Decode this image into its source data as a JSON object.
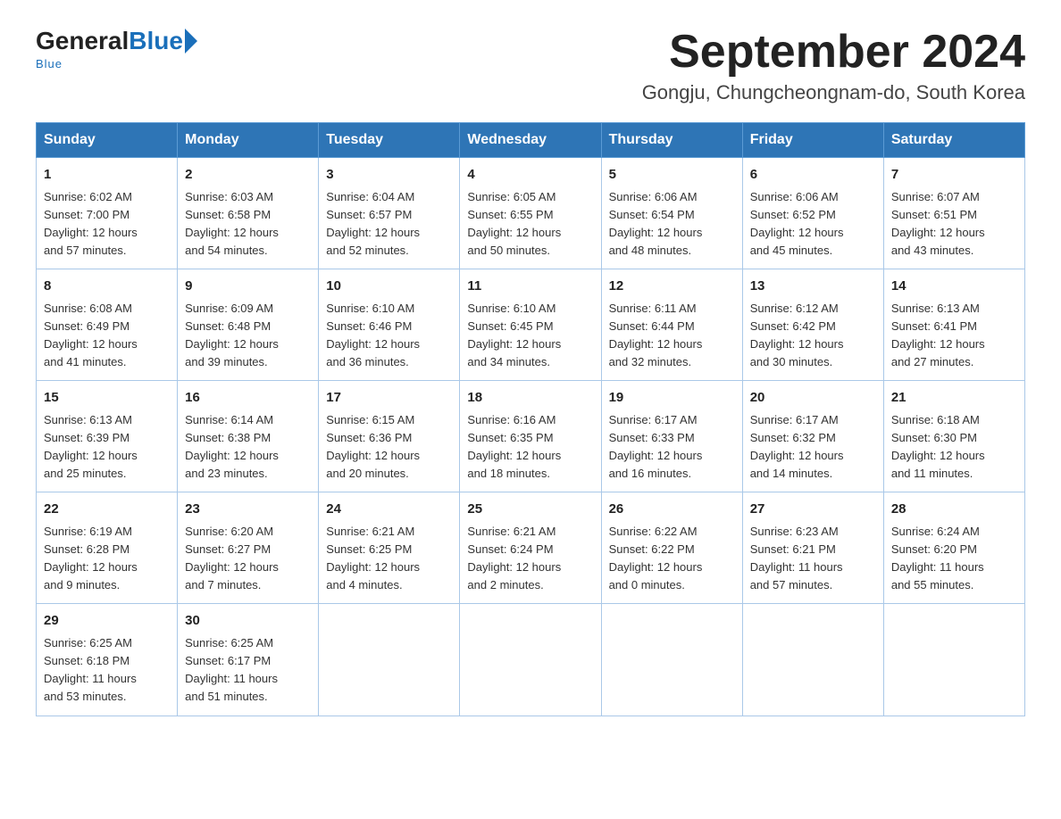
{
  "header": {
    "logo_general": "General",
    "logo_blue": "Blue",
    "logo_tagline": "Blue",
    "month_title": "September 2024",
    "subtitle": "Gongju, Chungcheongnam-do, South Korea"
  },
  "days_of_week": [
    "Sunday",
    "Monday",
    "Tuesday",
    "Wednesday",
    "Thursday",
    "Friday",
    "Saturday"
  ],
  "weeks": [
    [
      {
        "day": "1",
        "sunrise": "6:02 AM",
        "sunset": "7:00 PM",
        "daylight_hours": "12",
        "daylight_minutes": "57"
      },
      {
        "day": "2",
        "sunrise": "6:03 AM",
        "sunset": "6:58 PM",
        "daylight_hours": "12",
        "daylight_minutes": "54"
      },
      {
        "day": "3",
        "sunrise": "6:04 AM",
        "sunset": "6:57 PM",
        "daylight_hours": "12",
        "daylight_minutes": "52"
      },
      {
        "day": "4",
        "sunrise": "6:05 AM",
        "sunset": "6:55 PM",
        "daylight_hours": "12",
        "daylight_minutes": "50"
      },
      {
        "day": "5",
        "sunrise": "6:06 AM",
        "sunset": "6:54 PM",
        "daylight_hours": "12",
        "daylight_minutes": "48"
      },
      {
        "day": "6",
        "sunrise": "6:06 AM",
        "sunset": "6:52 PM",
        "daylight_hours": "12",
        "daylight_minutes": "45"
      },
      {
        "day": "7",
        "sunrise": "6:07 AM",
        "sunset": "6:51 PM",
        "daylight_hours": "12",
        "daylight_minutes": "43"
      }
    ],
    [
      {
        "day": "8",
        "sunrise": "6:08 AM",
        "sunset": "6:49 PM",
        "daylight_hours": "12",
        "daylight_minutes": "41"
      },
      {
        "day": "9",
        "sunrise": "6:09 AM",
        "sunset": "6:48 PM",
        "daylight_hours": "12",
        "daylight_minutes": "39"
      },
      {
        "day": "10",
        "sunrise": "6:10 AM",
        "sunset": "6:46 PM",
        "daylight_hours": "12",
        "daylight_minutes": "36"
      },
      {
        "day": "11",
        "sunrise": "6:10 AM",
        "sunset": "6:45 PM",
        "daylight_hours": "12",
        "daylight_minutes": "34"
      },
      {
        "day": "12",
        "sunrise": "6:11 AM",
        "sunset": "6:44 PM",
        "daylight_hours": "12",
        "daylight_minutes": "32"
      },
      {
        "day": "13",
        "sunrise": "6:12 AM",
        "sunset": "6:42 PM",
        "daylight_hours": "12",
        "daylight_minutes": "30"
      },
      {
        "day": "14",
        "sunrise": "6:13 AM",
        "sunset": "6:41 PM",
        "daylight_hours": "12",
        "daylight_minutes": "27"
      }
    ],
    [
      {
        "day": "15",
        "sunrise": "6:13 AM",
        "sunset": "6:39 PM",
        "daylight_hours": "12",
        "daylight_minutes": "25"
      },
      {
        "day": "16",
        "sunrise": "6:14 AM",
        "sunset": "6:38 PM",
        "daylight_hours": "12",
        "daylight_minutes": "23"
      },
      {
        "day": "17",
        "sunrise": "6:15 AM",
        "sunset": "6:36 PM",
        "daylight_hours": "12",
        "daylight_minutes": "20"
      },
      {
        "day": "18",
        "sunrise": "6:16 AM",
        "sunset": "6:35 PM",
        "daylight_hours": "12",
        "daylight_minutes": "18"
      },
      {
        "day": "19",
        "sunrise": "6:17 AM",
        "sunset": "6:33 PM",
        "daylight_hours": "12",
        "daylight_minutes": "16"
      },
      {
        "day": "20",
        "sunrise": "6:17 AM",
        "sunset": "6:32 PM",
        "daylight_hours": "12",
        "daylight_minutes": "14"
      },
      {
        "day": "21",
        "sunrise": "6:18 AM",
        "sunset": "6:30 PM",
        "daylight_hours": "12",
        "daylight_minutes": "11"
      }
    ],
    [
      {
        "day": "22",
        "sunrise": "6:19 AM",
        "sunset": "6:28 PM",
        "daylight_hours": "12",
        "daylight_minutes": "9"
      },
      {
        "day": "23",
        "sunrise": "6:20 AM",
        "sunset": "6:27 PM",
        "daylight_hours": "12",
        "daylight_minutes": "7"
      },
      {
        "day": "24",
        "sunrise": "6:21 AM",
        "sunset": "6:25 PM",
        "daylight_hours": "12",
        "daylight_minutes": "4"
      },
      {
        "day": "25",
        "sunrise": "6:21 AM",
        "sunset": "6:24 PM",
        "daylight_hours": "12",
        "daylight_minutes": "2"
      },
      {
        "day": "26",
        "sunrise": "6:22 AM",
        "sunset": "6:22 PM",
        "daylight_hours": "12",
        "daylight_minutes": "0"
      },
      {
        "day": "27",
        "sunrise": "6:23 AM",
        "sunset": "6:21 PM",
        "daylight_hours": "11",
        "daylight_minutes": "57"
      },
      {
        "day": "28",
        "sunrise": "6:24 AM",
        "sunset": "6:20 PM",
        "daylight_hours": "11",
        "daylight_minutes": "55"
      }
    ],
    [
      {
        "day": "29",
        "sunrise": "6:25 AM",
        "sunset": "6:18 PM",
        "daylight_hours": "11",
        "daylight_minutes": "53"
      },
      {
        "day": "30",
        "sunrise": "6:25 AM",
        "sunset": "6:17 PM",
        "daylight_hours": "11",
        "daylight_minutes": "51"
      },
      null,
      null,
      null,
      null,
      null
    ]
  ]
}
